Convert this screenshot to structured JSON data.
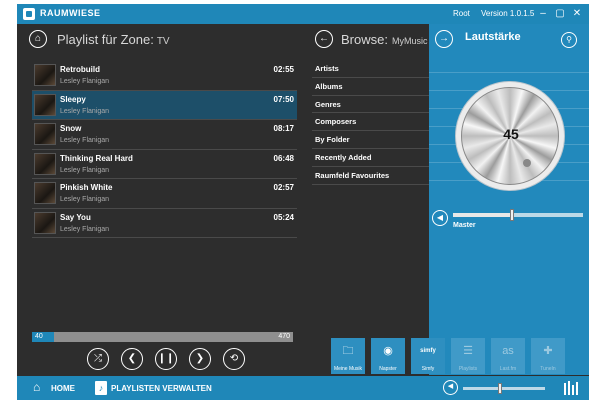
{
  "titlebar": {
    "app_name": "RAUMWIESE",
    "user": "Root",
    "version": "Version 1.0.1.5",
    "minimize": "–",
    "maximize": "▢",
    "close": "✕",
    "accent": "#1f87b8"
  },
  "playlist": {
    "title": "Playlist für Zone:",
    "zone": "TV",
    "home_icon": "home-icon",
    "tracks": [
      {
        "title": "Retrobuild",
        "artist": "Lesley Flanigan",
        "duration": "02:55",
        "selected": false
      },
      {
        "title": "Sleepy",
        "artist": "Lesley Flanigan",
        "duration": "07:50",
        "selected": true
      },
      {
        "title": "Snow",
        "artist": "Lesley Flanigan",
        "duration": "08:17",
        "selected": false
      },
      {
        "title": "Thinking Real Hard",
        "artist": "Lesley Flanigan",
        "duration": "06:48",
        "selected": false
      },
      {
        "title": "Pinkish White",
        "artist": "Lesley Flanigan",
        "duration": "02:57",
        "selected": false
      },
      {
        "title": "Say You",
        "artist": "Lesley Flanigan",
        "duration": "05:24",
        "selected": false
      }
    ]
  },
  "player": {
    "position": "40",
    "length": "470",
    "progress_fraction": 0.085,
    "shuffle": "⤮",
    "prev": "❮",
    "play_pause": "❙❙",
    "next": "❯",
    "repeat": "⟲"
  },
  "browse": {
    "title": "Browse:",
    "source": "MyMusic",
    "back_icon": "arrow-left-icon",
    "items": [
      "Artists",
      "Albums",
      "Genres",
      "Composers",
      "By Folder",
      "Recently Added",
      "Raumfeld Favourites"
    ]
  },
  "volume": {
    "title": "Lautstärke",
    "value": "45",
    "master_label": "Master",
    "master_level": 0.45,
    "forward_icon": "arrow-right-icon",
    "search_icon": "search-icon",
    "panel_color": "#2289bc"
  },
  "sources": [
    {
      "label": "Meine Musik",
      "icon": "folder-music-icon",
      "glyph": "🗀",
      "active": true
    },
    {
      "label": "Napster",
      "icon": "napster-icon",
      "glyph": "◉",
      "active": true
    },
    {
      "label": "Simfy",
      "icon": "simfy-icon",
      "glyph": "simfy",
      "active": true
    },
    {
      "label": "Playlists",
      "icon": "playlist-icon",
      "glyph": "☰",
      "active": false
    },
    {
      "label": "Last.fm",
      "icon": "lastfm-icon",
      "glyph": "as",
      "active": false
    },
    {
      "label": "TuneIn",
      "icon": "tunein-icon",
      "glyph": "✚",
      "active": false
    }
  ],
  "bottom_nav": {
    "home": "HOME",
    "playlists": "PLAYLISTEN VERWALTEN",
    "home_glyph": "⌂",
    "playlist_glyph": "♪",
    "speaker_glyph": "◀",
    "volume_level": 0.45
  }
}
